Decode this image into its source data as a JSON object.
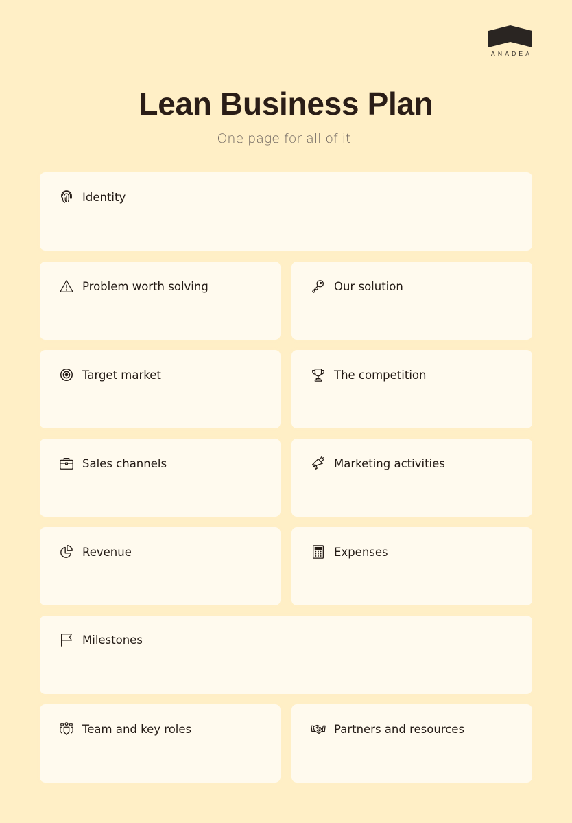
{
  "brand": {
    "name": "ANADEA",
    "logo_color": "#2A2522"
  },
  "header": {
    "title": "Lean Business Plan",
    "subtitle": "One page for all of it."
  },
  "colors": {
    "background": "#FFEFC6",
    "card": "#FFFAEE",
    "text": "#231A15",
    "subtitle": "#6F6660"
  },
  "sections": [
    {
      "label": "Identity",
      "icon": "fingerprint-icon"
    },
    {
      "label": "Problem worth solving",
      "icon": "warning-triangle-icon"
    },
    {
      "label": "Our solution",
      "icon": "key-icon"
    },
    {
      "label": "Target market",
      "icon": "target-icon"
    },
    {
      "label": "The competition",
      "icon": "trophy-icon"
    },
    {
      "label": "Sales channels",
      "icon": "briefcase-icon"
    },
    {
      "label": "Marketing activities",
      "icon": "megaphone-icon"
    },
    {
      "label": "Revenue",
      "icon": "pie-chart-icon"
    },
    {
      "label": "Expenses",
      "icon": "calculator-icon"
    },
    {
      "label": "Milestones",
      "icon": "flag-icon"
    },
    {
      "label": "Team and key roles",
      "icon": "team-icon"
    },
    {
      "label": "Partners and resources",
      "icon": "handshake-icon"
    }
  ]
}
